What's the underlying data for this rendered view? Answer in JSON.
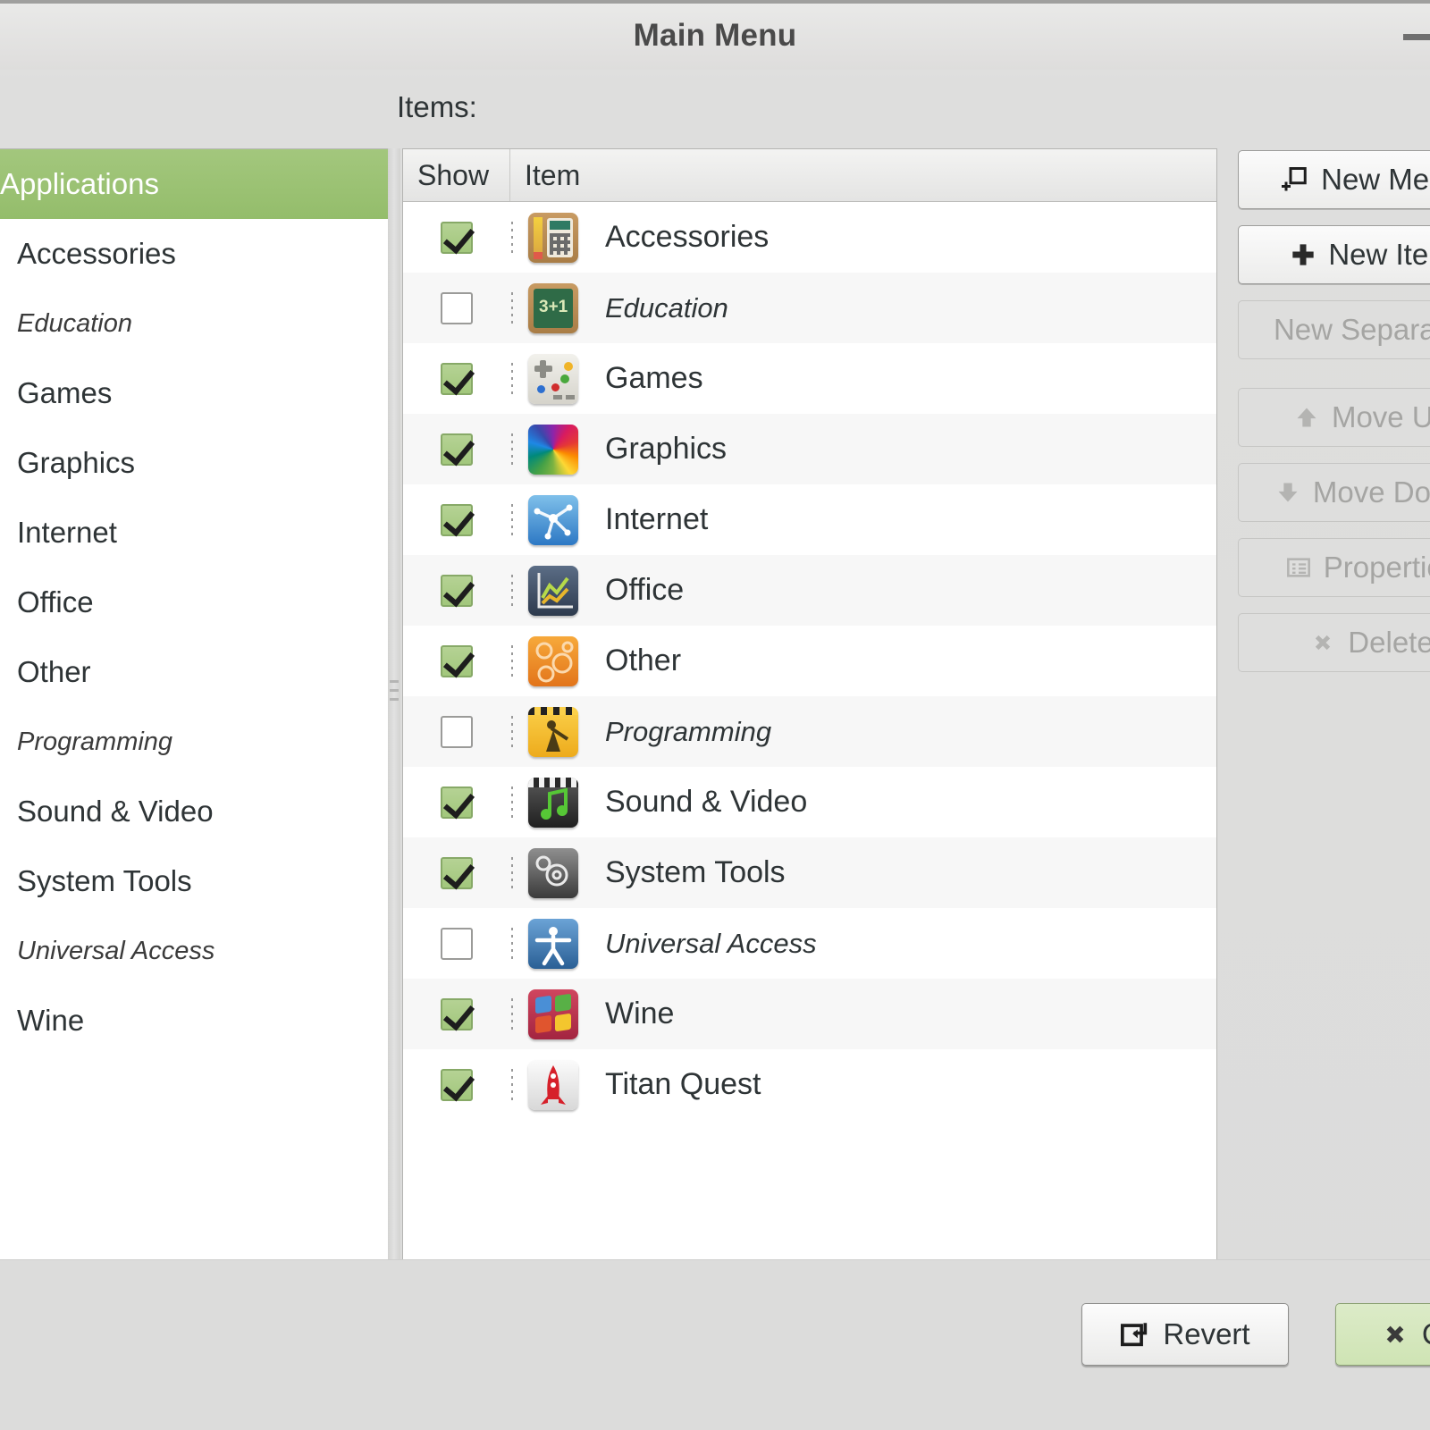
{
  "window": {
    "title": "Main Menu",
    "minimize_icon": "minimize-icon"
  },
  "items_label": "Items:",
  "sidebar": {
    "items": [
      {
        "label": "Applications",
        "selected": true,
        "dim": false
      },
      {
        "label": "Accessories",
        "selected": false,
        "dim": false
      },
      {
        "label": "Education",
        "selected": false,
        "dim": true
      },
      {
        "label": "Games",
        "selected": false,
        "dim": false
      },
      {
        "label": "Graphics",
        "selected": false,
        "dim": false
      },
      {
        "label": "Internet",
        "selected": false,
        "dim": false
      },
      {
        "label": "Office",
        "selected": false,
        "dim": false
      },
      {
        "label": "Other",
        "selected": false,
        "dim": false
      },
      {
        "label": "Programming",
        "selected": false,
        "dim": true
      },
      {
        "label": "Sound & Video",
        "selected": false,
        "dim": false
      },
      {
        "label": "System Tools",
        "selected": false,
        "dim": false
      },
      {
        "label": "Universal Access",
        "selected": false,
        "dim": true
      },
      {
        "label": "Wine",
        "selected": false,
        "dim": false
      }
    ]
  },
  "list": {
    "columns": [
      "Show",
      "Item"
    ],
    "rows": [
      {
        "show": true,
        "label": "Accessories",
        "icon": "accessories-icon",
        "dim": false
      },
      {
        "show": false,
        "label": "Education",
        "icon": "education-icon",
        "dim": true
      },
      {
        "show": true,
        "label": "Games",
        "icon": "games-icon",
        "dim": false
      },
      {
        "show": true,
        "label": "Graphics",
        "icon": "graphics-icon",
        "dim": false
      },
      {
        "show": true,
        "label": "Internet",
        "icon": "internet-icon",
        "dim": false
      },
      {
        "show": true,
        "label": "Office",
        "icon": "office-icon",
        "dim": false
      },
      {
        "show": true,
        "label": "Other",
        "icon": "other-icon",
        "dim": false
      },
      {
        "show": false,
        "label": "Programming",
        "icon": "programming-icon",
        "dim": true
      },
      {
        "show": true,
        "label": "Sound & Video",
        "icon": "sound-video-icon",
        "dim": false
      },
      {
        "show": true,
        "label": "System Tools",
        "icon": "system-tools-icon",
        "dim": false
      },
      {
        "show": false,
        "label": "Universal Access",
        "icon": "universal-access-icon",
        "dim": true
      },
      {
        "show": true,
        "label": "Wine",
        "icon": "wine-icon",
        "dim": false
      },
      {
        "show": true,
        "label": "Titan Quest",
        "icon": "titan-quest-icon",
        "dim": false
      }
    ]
  },
  "side_buttons": [
    {
      "label": "New Menu",
      "icon": "new-menu-icon",
      "enabled": true
    },
    {
      "label": "New Item",
      "icon": "plus-icon",
      "enabled": true
    },
    {
      "label": "New Separator",
      "icon": "",
      "enabled": false
    },
    {
      "label": "Move Up",
      "icon": "arrow-up-icon",
      "enabled": false
    },
    {
      "label": "Move Down",
      "icon": "arrow-down-icon",
      "enabled": false
    },
    {
      "label": "Properties",
      "icon": "properties-icon",
      "enabled": false
    },
    {
      "label": "Delete",
      "icon": "delete-icon",
      "enabled": false
    }
  ],
  "footer": {
    "revert_label": "Revert",
    "revert_icon": "revert-icon",
    "close_label": "Close",
    "close_icon": "close-x-icon"
  },
  "colors": {
    "selection_green": "#9ac272",
    "checkbox_green": "#a9cb84",
    "window_bg": "#dcdcdb",
    "list_alt_row": "#f7f7f7",
    "close_button_green": "#d4e7bd"
  }
}
